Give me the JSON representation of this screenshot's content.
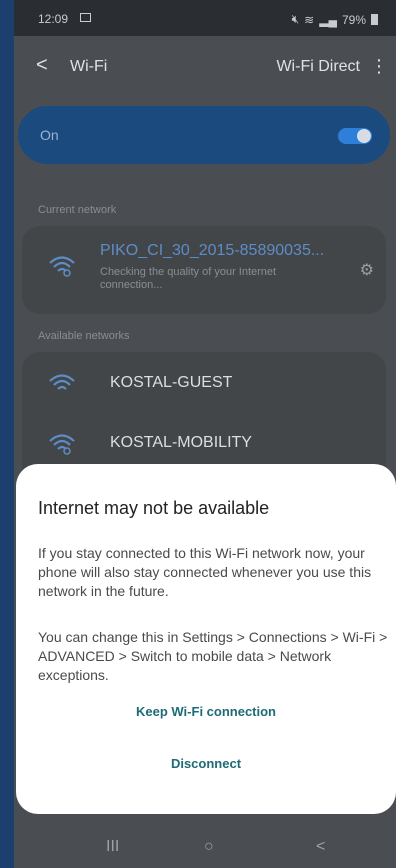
{
  "status_bar": {
    "time": "12:09",
    "icons": [
      "image-icon",
      "mute-icon",
      "wifi-signal-icon",
      "cell-signal-icon"
    ],
    "battery": "79%"
  },
  "app_bar": {
    "title": "Wi-Fi",
    "action": "Wi-Fi Direct"
  },
  "wifi_toggle": {
    "label": "On",
    "enabled": true,
    "accent_color": "#2d7fd9"
  },
  "current_network": {
    "section_label": "Current network",
    "name": "PIKO_CI_30_2015-85890035...",
    "status": "Checking the quality of your Internet connection...",
    "name_color": "#5d8cc6"
  },
  "available_networks": {
    "section_label": "Available networks",
    "items": [
      {
        "name": "KOSTAL-GUEST"
      },
      {
        "name": "KOSTAL-MOBILITY"
      }
    ]
  },
  "dialog": {
    "title": "Internet may not be available",
    "paragraph_1": "If you stay connected to this Wi-Fi network now, your phone will also stay connected whenever you use this network in the future.",
    "paragraph_2": "You can change this in Settings > Connections > Wi-Fi > ADVANCED > Switch to mobile data > Network exceptions.",
    "primary_button": "Keep Wi-Fi connection",
    "secondary_button": "Disconnect",
    "button_color": "#1e6b77"
  },
  "nav_bar": {
    "recent": "III",
    "home": "○",
    "back": "<"
  }
}
